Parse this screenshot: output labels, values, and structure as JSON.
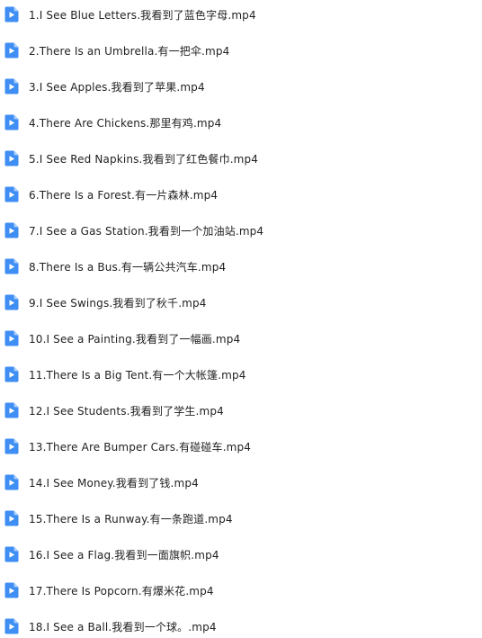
{
  "file_list": {
    "icon": "video-file-icon",
    "icon_color": "#3f8ef4",
    "files": [
      {
        "name": "1.I See Blue Letters.我看到了蓝色字母.mp4"
      },
      {
        "name": "2.There Is an Umbrella.有一把伞.mp4"
      },
      {
        "name": "3.I See Apples.我看到了苹果.mp4"
      },
      {
        "name": "4.There Are Chickens.那里有鸡.mp4"
      },
      {
        "name": "5.I See Red Napkins.我看到了红色餐巾.mp4"
      },
      {
        "name": "6.There Is a Forest.有一片森林.mp4"
      },
      {
        "name": "7.I See a Gas Station.我看到一个加油站.mp4"
      },
      {
        "name": "8.There Is a Bus.有一辆公共汽车.mp4"
      },
      {
        "name": "9.I See Swings.我看到了秋千.mp4"
      },
      {
        "name": "10.I See a Painting.我看到了一幅画.mp4"
      },
      {
        "name": "11.There Is a Big Tent.有一个大帐篷.mp4"
      },
      {
        "name": "12.I See Students.我看到了学生.mp4"
      },
      {
        "name": "13.There Are Bumper Cars.有碰碰车.mp4"
      },
      {
        "name": "14.I See Money.我看到了钱.mp4"
      },
      {
        "name": "15.There Is a Runway.有一条跑道.mp4"
      },
      {
        "name": "16.I See a Flag.我看到一面旗帜.mp4"
      },
      {
        "name": "17.There Is Popcorn.有爆米花.mp4"
      },
      {
        "name": "18.I See a Ball.我看到一个球。.mp4"
      }
    ]
  }
}
